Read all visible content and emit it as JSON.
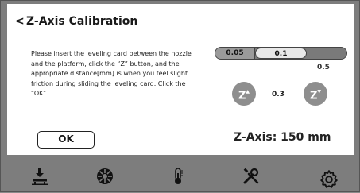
{
  "header": {
    "back_label": "<",
    "title": "Z-Axis Calibration"
  },
  "instructions": "Please insert the leveling card between the nozzle and the platform, click the “Z” button, and the appropriate distance[mm] is when you feel slight friction during sliding the leveling card. Click the “OK”.",
  "step_options": [
    "0.05",
    "0.1",
    "0.5"
  ],
  "selected_step": "0.1",
  "z_up_label": "Z",
  "z_down_label": "Z",
  "current_step": "0.3",
  "ok_label": "OK",
  "z_axis_label": "Z-Axis:  150 mm",
  "nav": {
    "items": [
      "print-bed-icon",
      "filament-icon",
      "temperature-icon",
      "tools-icon",
      "settings-icon"
    ]
  },
  "colors": {
    "panel": "#ffffff",
    "nav_bg": "#7d7d7d",
    "selected_segment": "#e8e8e8"
  }
}
